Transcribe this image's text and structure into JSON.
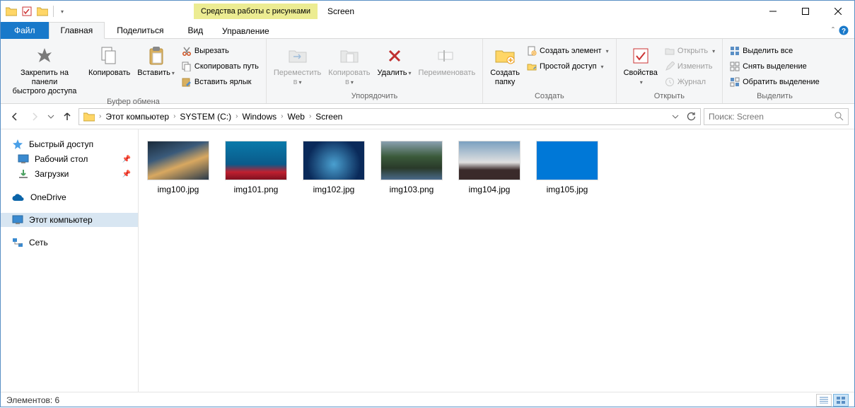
{
  "title": "Screen",
  "contextual_tab": "Средства работы с рисунками",
  "tabs": {
    "file": "Файл",
    "home": "Главная",
    "share": "Поделиться",
    "view": "Вид",
    "manage": "Управление"
  },
  "ribbon": {
    "clipboard": {
      "label": "Буфер обмена",
      "pin": "Закрепить на панели\nбыстрого доступа",
      "copy": "Копировать",
      "paste": "Вставить",
      "cut": "Вырезать",
      "copy_path": "Скопировать путь",
      "paste_shortcut": "Вставить ярлык"
    },
    "organize": {
      "label": "Упорядочить",
      "move_to": "Переместить\nв",
      "copy_to": "Копировать\nв",
      "delete": "Удалить",
      "rename": "Переименовать"
    },
    "new": {
      "label": "Создать",
      "new_folder": "Создать\nпапку",
      "new_item": "Создать элемент",
      "easy_access": "Простой доступ"
    },
    "open": {
      "label": "Открыть",
      "properties": "Свойства",
      "open": "Открыть",
      "edit": "Изменить",
      "history": "Журнал"
    },
    "select": {
      "label": "Выделить",
      "select_all": "Выделить все",
      "select_none": "Снять выделение",
      "invert": "Обратить выделение"
    }
  },
  "breadcrumb": [
    "Этот компьютер",
    "SYSTEM (C:)",
    "Windows",
    "Web",
    "Screen"
  ],
  "search_placeholder": "Поиск: Screen",
  "nav": {
    "quick_access": "Быстрый доступ",
    "desktop": "Рабочий стол",
    "downloads": "Загрузки",
    "onedrive": "OneDrive",
    "this_pc": "Этот компьютер",
    "network": "Сеть"
  },
  "files": [
    {
      "name": "img100.jpg",
      "bg": "linear-gradient(160deg,#1a2a3a 0%,#3a5a7a 35%,#d8a860 60%,#2a3a4a 100%)"
    },
    {
      "name": "img101.png",
      "bg": "linear-gradient(180deg,#0a7aaa 0%,#0a5a8a 60%,#c02030 80%,#801020 100%)"
    },
    {
      "name": "img102.jpg",
      "bg": "radial-gradient(circle at 50% 60%,#4aa0d0 0%,#0a2a5a 70%)"
    },
    {
      "name": "img103.png",
      "bg": "linear-gradient(180deg,#8aa0b0 0%,#3a5a3a 40%,#2a3a2a 70%,#4a6a8a 100%)"
    },
    {
      "name": "img104.jpg",
      "bg": "linear-gradient(180deg,#7aa0c0 0%,#e0e0e0 55%,#3a2a2a 75%)"
    },
    {
      "name": "img105.jpg",
      "bg": "#0078d7"
    }
  ],
  "status": {
    "count_label": "Элементов: 6"
  }
}
